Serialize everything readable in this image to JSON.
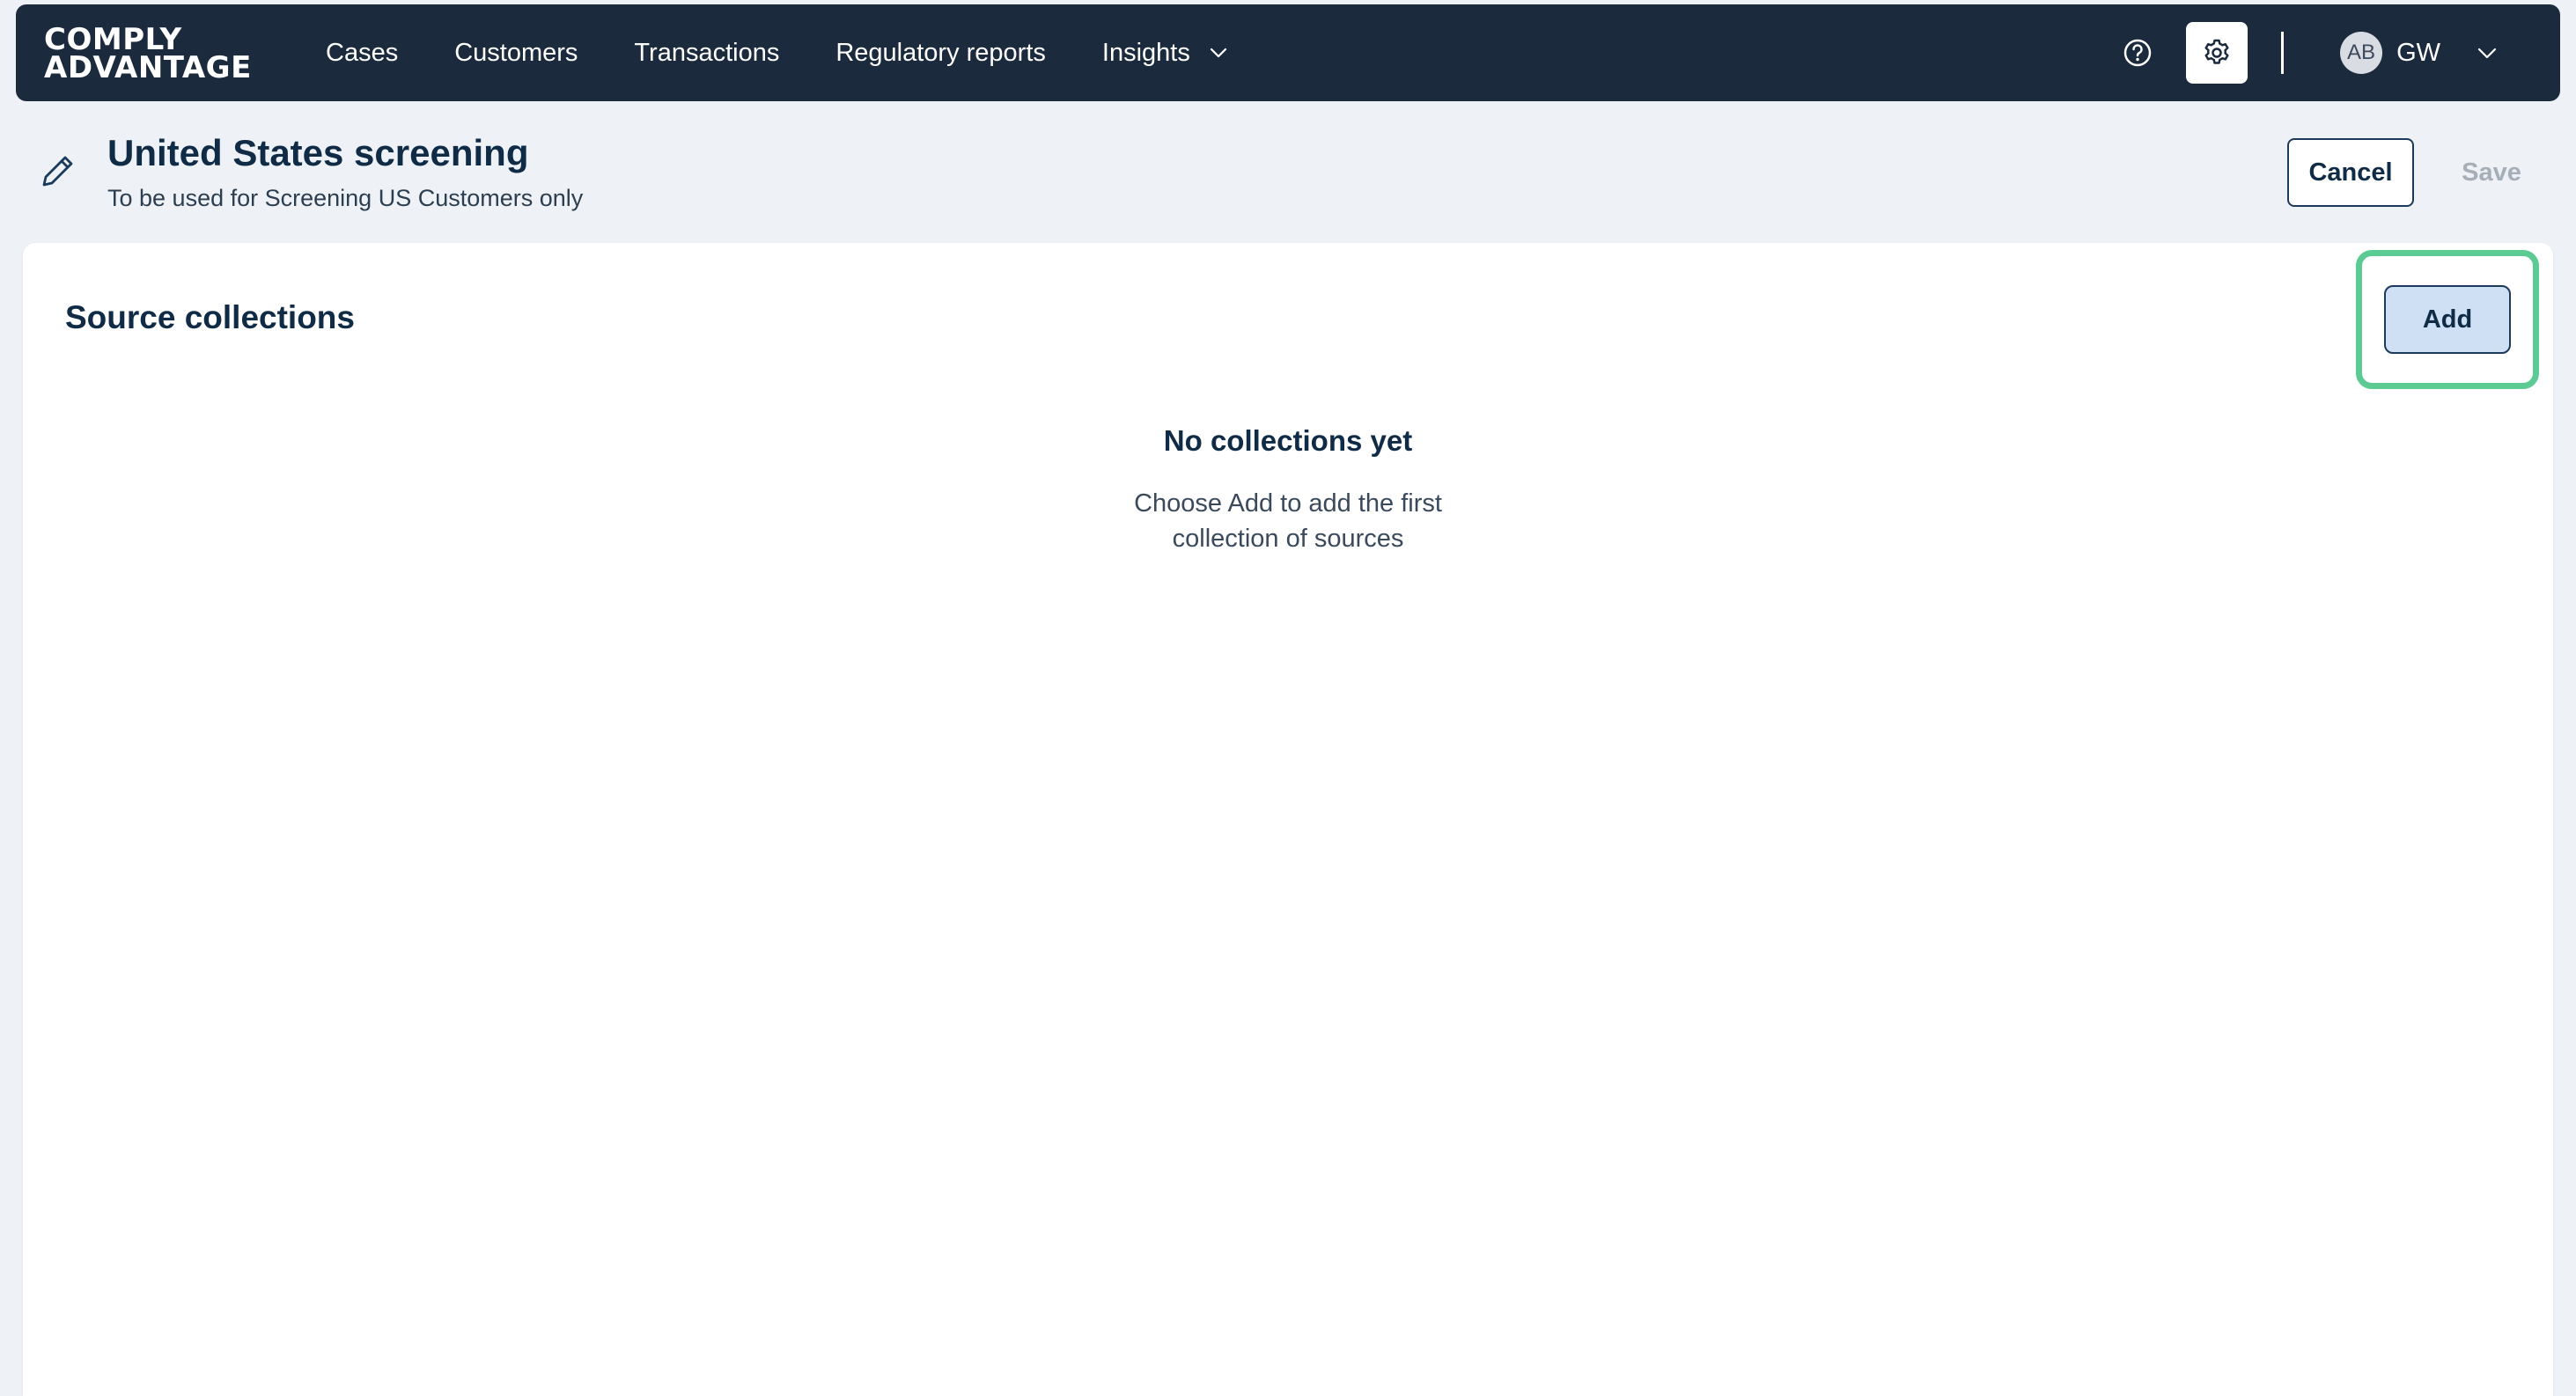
{
  "brand": {
    "line1": "COMPLY",
    "line2": "ADVANTAGE"
  },
  "nav": {
    "items": [
      {
        "label": "Cases"
      },
      {
        "label": "Customers"
      },
      {
        "label": "Transactions"
      },
      {
        "label": "Regulatory reports"
      },
      {
        "label": "Insights"
      }
    ],
    "user": {
      "avatar_initials": "AB",
      "initials": "GW"
    }
  },
  "icons": {
    "help": "help-circle-icon",
    "settings": "gear-icon",
    "dropdown": "chevron-down-icon",
    "edit": "pencil-icon"
  },
  "header": {
    "title": "United States screening",
    "subtitle": "To be used for Screening US Customers only",
    "cancel_label": "Cancel",
    "save_label": "Save"
  },
  "section": {
    "title": "Source collections",
    "add_label": "Add",
    "empty_title": "No collections yet",
    "empty_line1": "Choose Add to add the first",
    "empty_line2": "collection of sources"
  },
  "colors": {
    "nav_bg": "#1b2a3d",
    "page_bg": "#eef2f6",
    "primary_text": "#0f2b46",
    "add_bg": "#cfe0f5",
    "highlight": "#5ccb93",
    "disabled": "#a6aeb8"
  }
}
